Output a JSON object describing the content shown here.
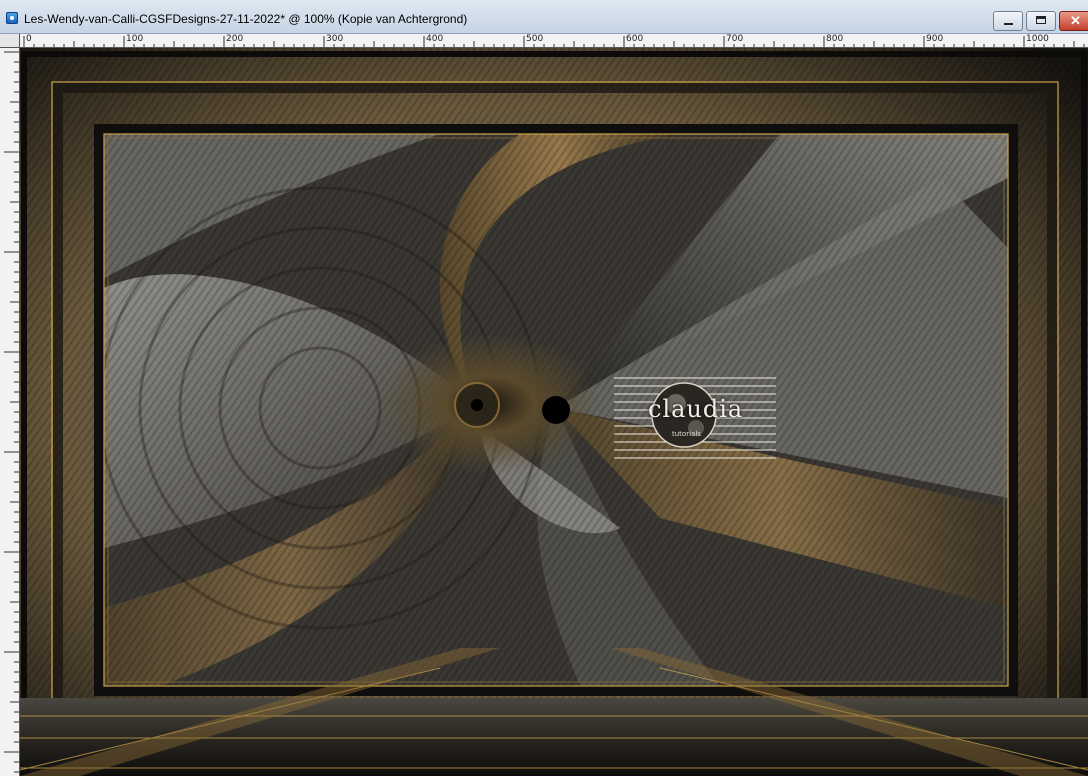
{
  "window": {
    "title": "Les-Wendy-van-Calli-CGSFDesigns-27-11-2022* @ 100% (Kopie van Achtergrond)",
    "buttons": {
      "minimize": "minimize-icon",
      "maximize": "maximize-icon",
      "close": "close-icon"
    }
  },
  "ruler": {
    "top_labels": [
      "0",
      "100",
      "200",
      "300",
      "400",
      "500",
      "600",
      "700",
      "800",
      "900",
      "1000"
    ]
  },
  "watermark": {
    "text": "claudia",
    "subtext": "tutorials"
  },
  "colors": {
    "gold": "#c9a24a",
    "bronze": "#8a6a35",
    "dark": "#151310"
  }
}
